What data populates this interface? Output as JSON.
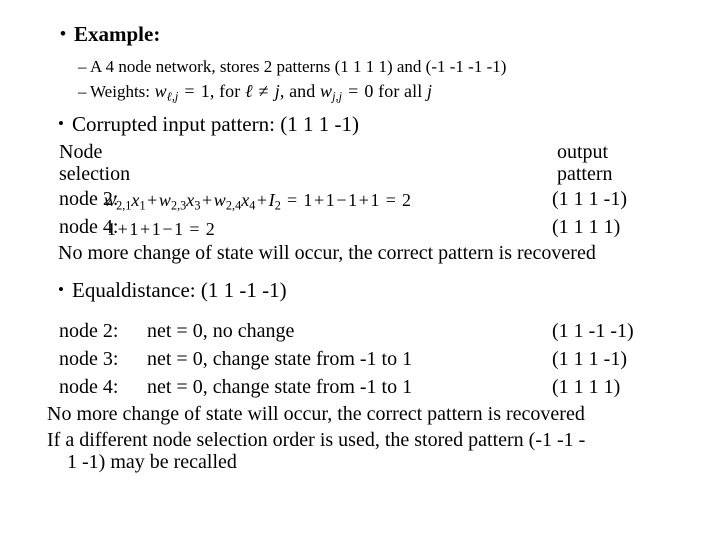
{
  "slide": {
    "background_color": "#ffffff",
    "text_color": "#000000"
  },
  "section_example": {
    "bullet_glyph": "•",
    "title": "Example:",
    "sub_bullet_glyph": "–",
    "sub_items": [
      "A 4 node network, stores 2 patterns (1 1 1 1) and (-1 -1 -1 -1)"
    ],
    "weights_label": "Weights:",
    "weights_formula_plain": "wℓ,j = 1, for ℓ ≠ j, and wj,j = 0 for all j"
  },
  "section_corrupted": {
    "bullet_glyph": "•",
    "heading": "Corrupted input pattern: (1 1 1 -1)",
    "column_headers": {
      "left_line1": "Node",
      "left_line2": "selection",
      "right_line1": "output",
      "right_line2": "pattern"
    },
    "rows": [
      {
        "label": "node 2:",
        "formula_plain": "w2,1x1 + w2,3x3 + w2,4x4 + I2 = 1+1−1+1 = 2",
        "pattern": "(1 1 1 -1)"
      },
      {
        "label": "node 4:",
        "formula_plain": "1+1+1−1 = 2",
        "pattern": "(1 1 1 1)"
      }
    ],
    "footer": "No more change of state will occur, the correct pattern is recovered"
  },
  "section_equaldistance": {
    "bullet_glyph": "•",
    "heading": "Equaldistance: (1 1 -1 -1)",
    "rows": [
      {
        "label": "node 2:",
        "text": "net = 0, no change",
        "pattern": "(1 1 -1 -1)"
      },
      {
        "label": "node 3:",
        "text": "net = 0, change state from -1 to 1",
        "pattern": "(1 1 1 -1)"
      },
      {
        "label": "node 4:",
        "text": "net = 0, change state from -1 to 1",
        "pattern": "(1 1 1 1)"
      }
    ],
    "footer_line1": "No more change of state will occur, the correct pattern is recovered",
    "footer_line2": "If a different node selection order is used, the stored pattern (-1 -1 -\n    1 -1) may be recalled"
  }
}
